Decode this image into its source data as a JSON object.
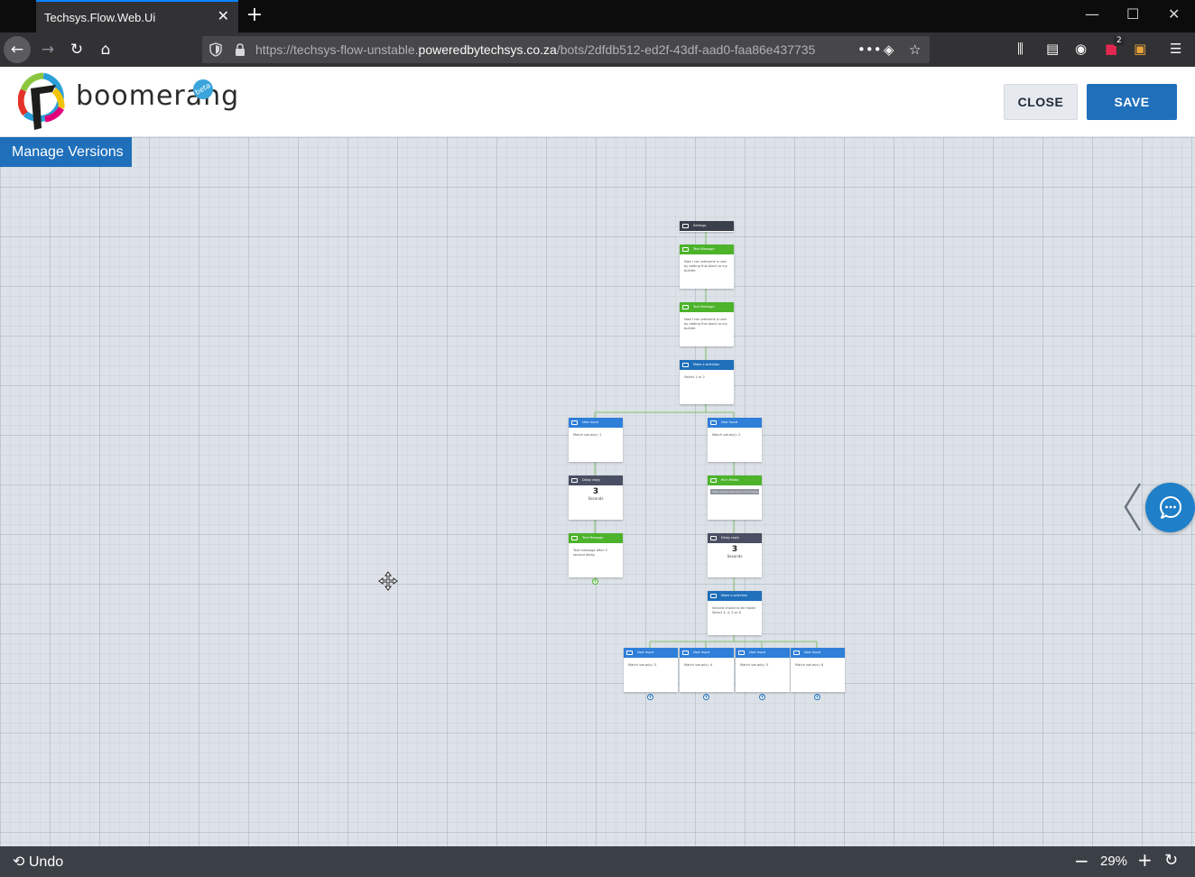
{
  "browser": {
    "tab_title": "Techsys.Flow.Web.Ui",
    "url_prefix": "https://techsys-flow-unstable.",
    "url_host": "poweredbytechsys.co.za",
    "url_path": "/bots/2dfdb512-ed2f-43df-aad0-faa86e437735",
    "extension_badge": "2"
  },
  "header": {
    "logo_text": "boomerang",
    "beta_label": "beta",
    "close_label": "CLOSE",
    "save_label": "SAVE"
  },
  "canvas": {
    "manage_versions_label": "Manage Versions"
  },
  "flow": {
    "settings": "Settings",
    "text_message_1": {
      "title": "Text Message",
      "body": "Now I can welcome a user by adding this block to my builder."
    },
    "text_message_2": {
      "title": "Text Message",
      "body": "Now I can welcome a user by adding this block to my builder."
    },
    "make_selection_1": {
      "title": "Make a selection",
      "body": "Select 1 or 2"
    },
    "user_input_1": {
      "title": "User Input",
      "body": "Match value(s): 1"
    },
    "user_input_2": {
      "title": "User Input",
      "body": "Match value(s): 2"
    },
    "delay_1": {
      "title": "Delay reply",
      "value": "3",
      "unit": "Seconds"
    },
    "text_message_3": {
      "title": "Text Message",
      "body": "Text message after 3 second delay."
    },
    "rich_media": {
      "title": "Rich Media",
      "body": "https://www.example.com/image.jpg"
    },
    "delay_2": {
      "title": "Delay reply",
      "value": "3",
      "unit": "Seconds"
    },
    "make_selection_2": {
      "title": "Make a selection",
      "body": "Second choice to be made. Select 3, 4, 5 or 6"
    },
    "user_input_3": {
      "title": "User Input",
      "body": "Match value(s): 3"
    },
    "user_input_4": {
      "title": "User Input",
      "body": "Match value(s): 4"
    },
    "user_input_5": {
      "title": "User Input",
      "body": "Match value(s): 5"
    },
    "user_input_6": {
      "title": "User Input",
      "body": "Match value(s): 6"
    }
  },
  "bottom": {
    "undo_label": "Undo",
    "zoom_level": "29%"
  },
  "colors": {
    "brand_blue": "#1f6fba",
    "node_green": "#4cb32b",
    "node_dark": "#3a3f4c",
    "bottom_bar": "#3b3f46"
  }
}
